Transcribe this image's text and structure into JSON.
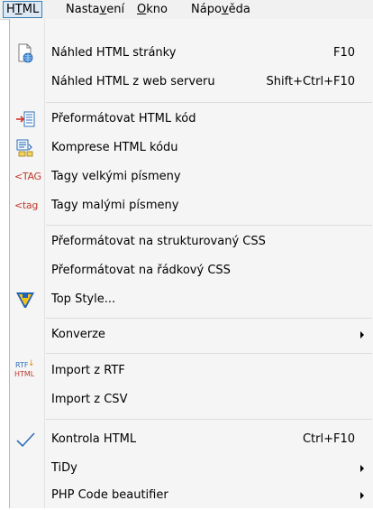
{
  "menubar": {
    "items": [
      {
        "pre": "H",
        "mn": "T",
        "post": "ML"
      },
      {
        "pre": "Nasta",
        "mn": "v",
        "post": "ení"
      },
      {
        "pre": "",
        "mn": "O",
        "post": "kno"
      },
      {
        "pre": "Nápo",
        "mn": "v",
        "post": "ěda"
      }
    ]
  },
  "menu": {
    "items": [
      {
        "label": "Náhled HTML stránky",
        "shortcut": "F10"
      },
      {
        "label": "Náhled HTML z web serveru",
        "shortcut": "Shift+Ctrl+F10"
      },
      {
        "label": "Přeformátovat HTML kód"
      },
      {
        "label": "Komprese HTML kódu"
      },
      {
        "label": "Tagy velkými písmeny",
        "icon_text": "TAG"
      },
      {
        "label": "Tagy malými písmeny",
        "icon_text": "tag"
      },
      {
        "label": "Přeformátovat na strukturovaný CSS"
      },
      {
        "label": "Přeformátovat na řádkový CSS"
      },
      {
        "label": "Top Style..."
      },
      {
        "label": "Konverze"
      },
      {
        "label": "Import z RTF",
        "icon_text_top": "RTF",
        "icon_text_bottom": "HTML"
      },
      {
        "label": "Import z CSV"
      },
      {
        "label": "Kontrola HTML",
        "shortcut": "Ctrl+F10"
      },
      {
        "label": "TiDy"
      },
      {
        "label": "PHP Code beautifier"
      }
    ]
  },
  "colors": {
    "active_menu_bg": "#dde8f5",
    "active_menu_border": "#3c7fb1",
    "accent_blue": "#2f6fb8",
    "accent_red": "#c0392b"
  }
}
